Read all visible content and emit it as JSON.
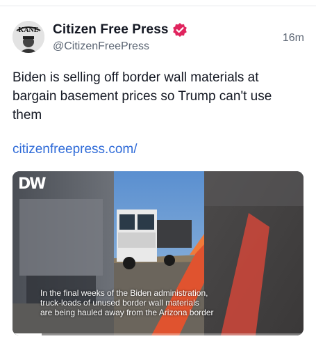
{
  "post": {
    "author": {
      "display_name": "Citizen Free Press",
      "handle": "@CitizenFreePress",
      "avatar_text": "KANE",
      "verified": true,
      "verified_color": "#e0245e",
      "avatar_icon": "avatar-logo-icon"
    },
    "timestamp": "16m",
    "text": "Biden is selling off border wall materials at bargain basement prices so Trump can't use them",
    "link": "citizenfreepress.com/",
    "link_color": "#2f6bd8",
    "media": {
      "type": "video",
      "logo": "DW",
      "caption_lines": [
        "In the final weeks of the Biden administration,",
        "truck-loads of unused border wall materials",
        "are being hauled away from the Arizona border"
      ],
      "progress": 0.1
    }
  }
}
